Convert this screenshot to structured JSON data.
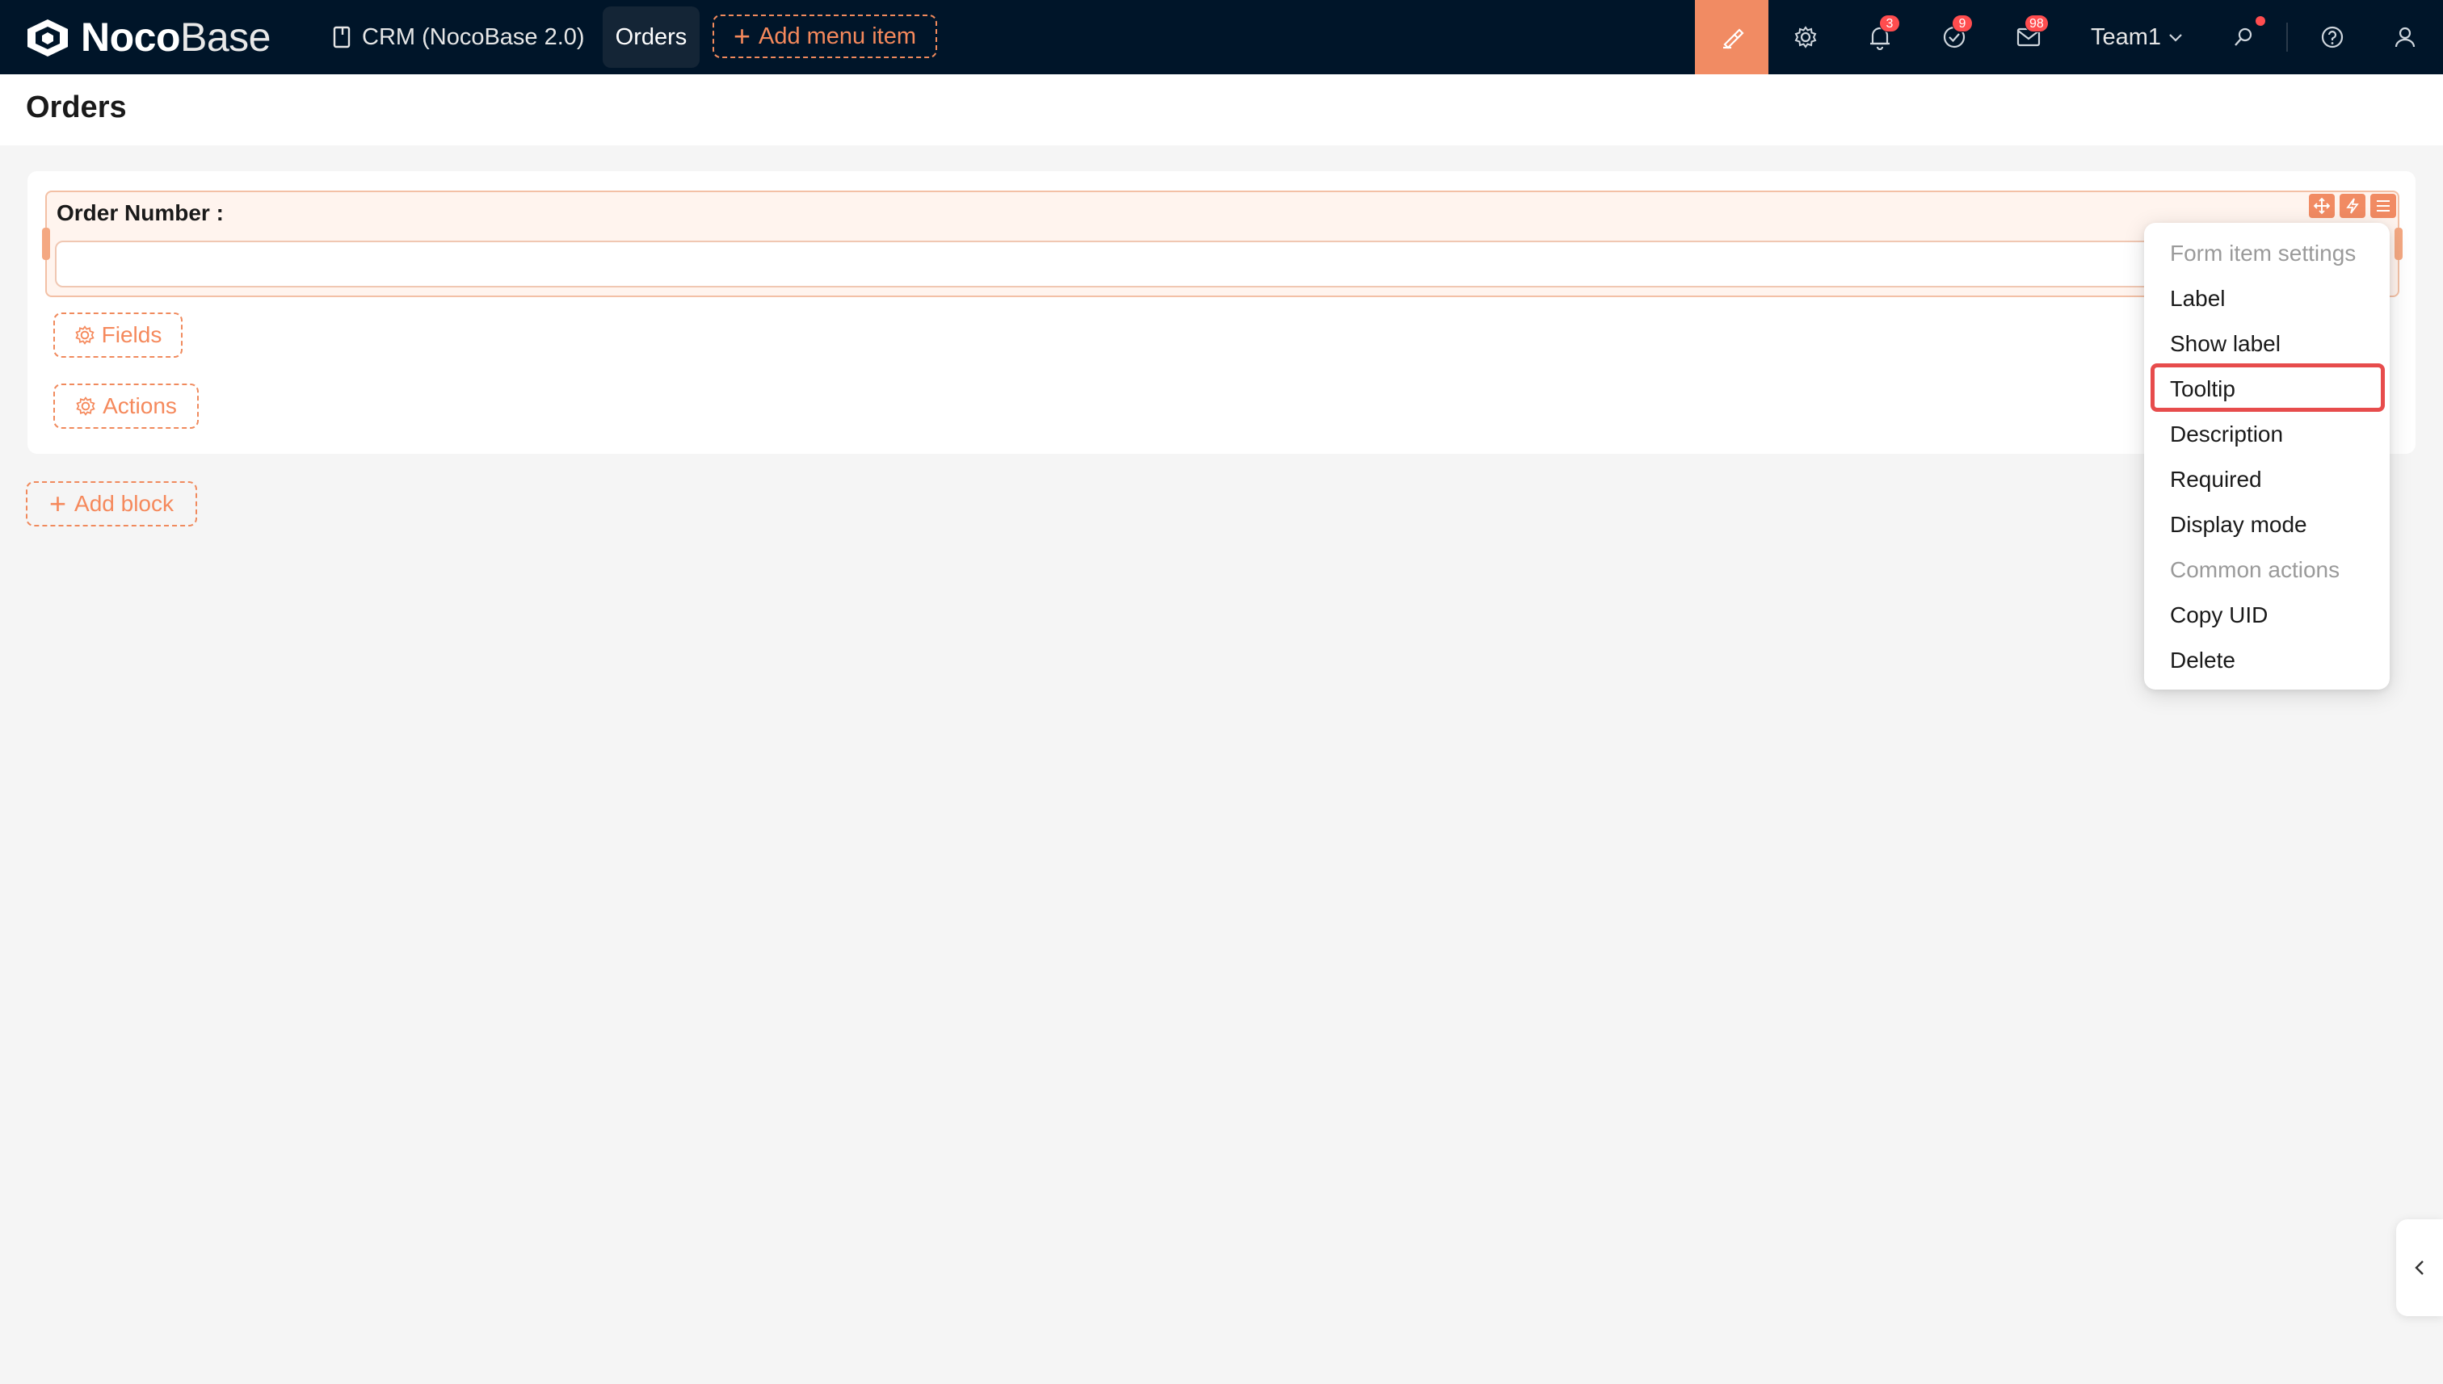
{
  "app": {
    "logo_bold": "Noco",
    "logo_light": "Base"
  },
  "nav": {
    "crm_label": "CRM (NocoBase 2.0)",
    "orders_label": "Orders",
    "add_menu_label": "Add menu item"
  },
  "topbar": {
    "notifications_count": "3",
    "tasks_count": "9",
    "messages_count": "98",
    "team_label": "Team1"
  },
  "page": {
    "title": "Orders"
  },
  "form": {
    "field_label": "Order Number :",
    "field_value": "",
    "fields_button": "Fields",
    "actions_button": "Actions"
  },
  "add_block_label": "Add block",
  "menu": {
    "group_form_item": "Form item settings",
    "items": [
      "Label",
      "Show label",
      "Tooltip",
      "Description",
      "Required",
      "Display mode"
    ],
    "group_common": "Common actions",
    "common_items": [
      "Copy UID",
      "Delete"
    ],
    "highlighted": "Tooltip"
  },
  "colors": {
    "topbar": "#001529",
    "accent": "#f18b63",
    "badge": "#ff4d4f",
    "highlight_border": "#e74c4c"
  }
}
